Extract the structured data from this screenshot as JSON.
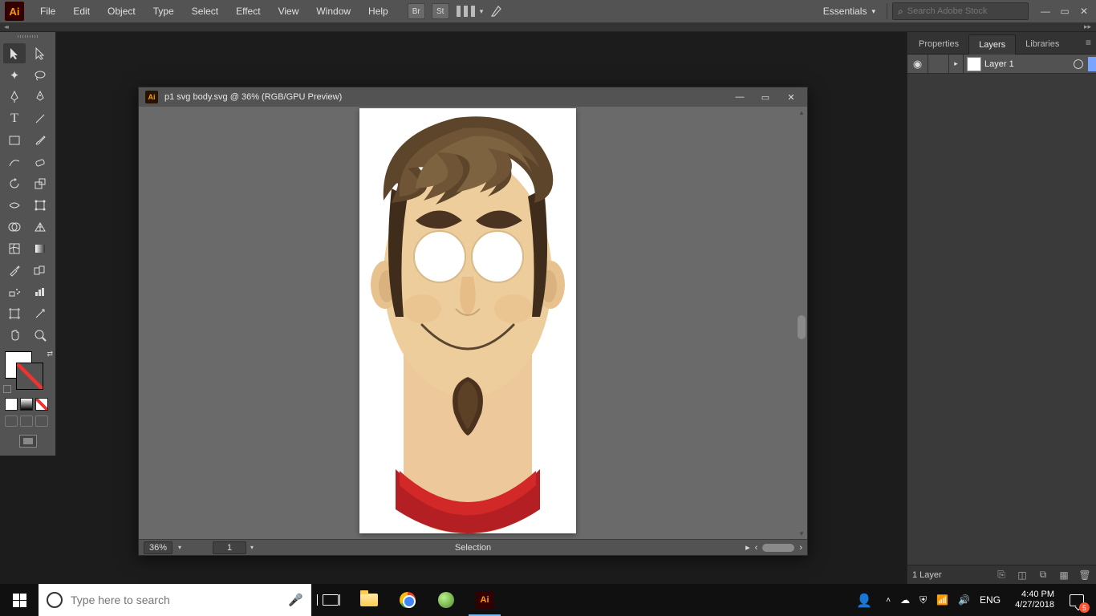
{
  "app_logo": "Ai",
  "menus": {
    "file": "File",
    "edit": "Edit",
    "object": "Object",
    "type": "Type",
    "select": "Select",
    "effect": "Effect",
    "view": "View",
    "window": "Window",
    "help": "Help"
  },
  "extras": {
    "br": "Br",
    "st": "St"
  },
  "workspace": "Essentials",
  "search_placeholder": "Search Adobe Stock",
  "document": {
    "title": "p1 svg body.svg @ 36% (RGB/GPU Preview)",
    "zoom": "36%",
    "artboard_num": "1",
    "tool_status": "Selection"
  },
  "panels": {
    "tabs": {
      "properties": "Properties",
      "layers": "Layers",
      "libraries": "Libraries"
    },
    "layers": {
      "layer1_name": "Layer 1",
      "count_label": "1 Layer"
    }
  },
  "taskbar": {
    "search_placeholder": "Type here to search",
    "lang": "ENG",
    "time": "4:40 PM",
    "date": "4/27/2018",
    "notif_count": "5"
  }
}
